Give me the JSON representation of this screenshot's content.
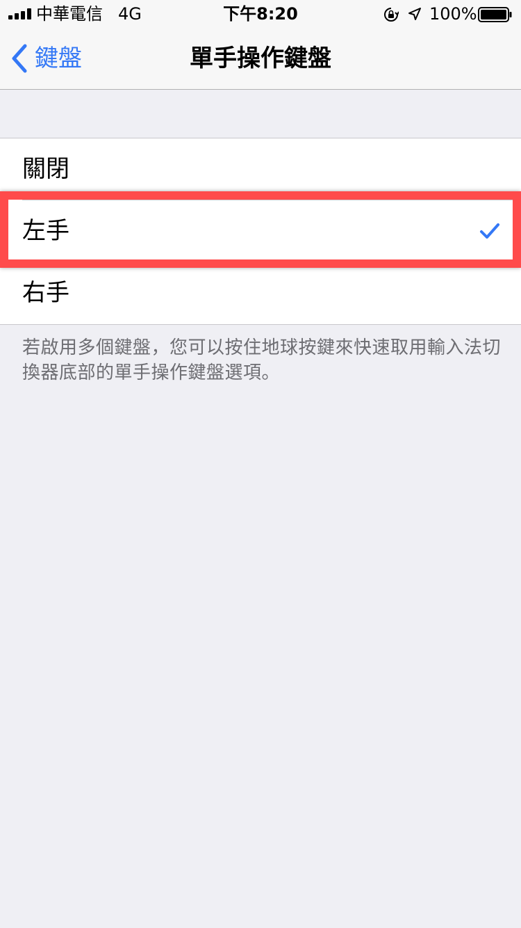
{
  "status_bar": {
    "carrier": "中華電信",
    "network": "4G",
    "time": "下午8:20",
    "battery_percent": "100%",
    "icons": [
      "signal-icon",
      "rotation-lock-icon",
      "location-icon",
      "battery-icon"
    ]
  },
  "nav": {
    "back_label": "鍵盤",
    "title": "單手操作鍵盤"
  },
  "options": [
    {
      "label": "關閉",
      "selected": false
    },
    {
      "label": "左手",
      "selected": true
    },
    {
      "label": "右手",
      "selected": false
    }
  ],
  "footer_note": "若啟用多個鍵盤，您可以按住地球按鍵來快速取用輸入法切換器底部的單手操作鍵盤選項。",
  "colors": {
    "accent": "#3478f6",
    "highlight": "#ff4b4b",
    "background": "#efeff4"
  }
}
